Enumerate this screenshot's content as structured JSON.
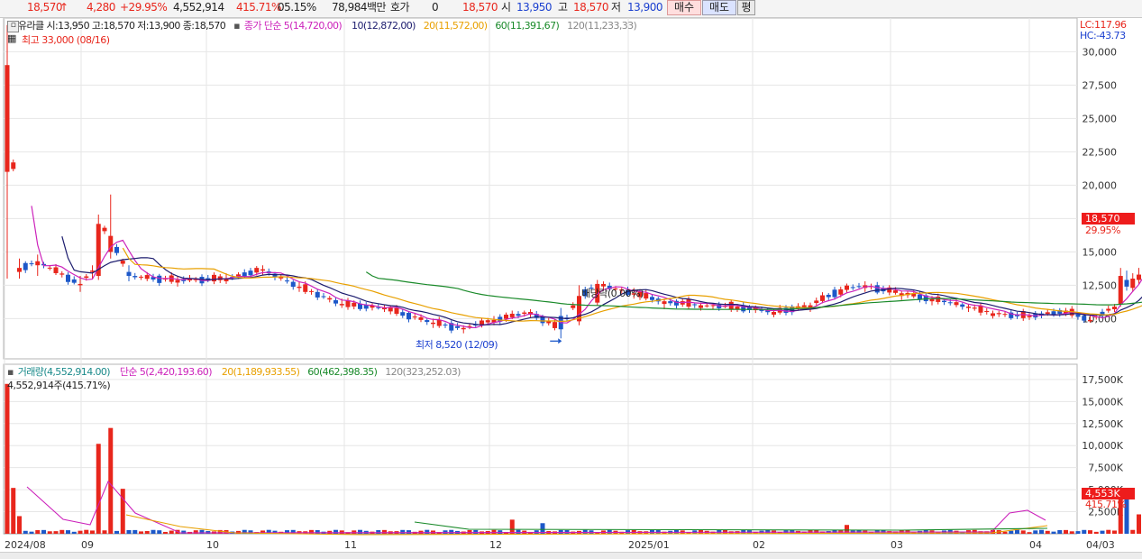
{
  "ticker": {
    "price": "18,570",
    "price_arrow": "↑",
    "change": "4,280",
    "change_pct": "+29.95%",
    "volume": "4,552,914",
    "volume_ratio": "415.71%",
    "turnover": "05.15%",
    "trade_value": "78,984백만",
    "hoga_label": "호가",
    "hoga_value": "0",
    "hoga_price": "18,570",
    "open_label": "시",
    "open_value": "13,950",
    "high_label": "고",
    "high_value": "18,570",
    "low_label": "저",
    "low_value": "13,900",
    "buy_button": "매수",
    "sell_button": "매도",
    "avg_button": "평"
  },
  "price_panel": {
    "stock_legend": "유라클 시:13,950 고:18,570 저:13,900 종:18,570",
    "ma_title": "종가 단순 5(14,720,00)",
    "ma10": "10(12,872,00)",
    "ma20": "20(11,572,00)",
    "ma60": "60(11,391,67)",
    "ma120": "120(11,233,33)",
    "high_note": "최고 33,000 (08/16)",
    "low_note": "최저 8,520 (12/09)",
    "dividend_note": "배당락(0.00%)",
    "lc": "LC:117.96",
    "hc": "HC:-43.73",
    "price_tag": "18,570",
    "pct_tag": "29.95%",
    "y_ticks": [
      "30,000",
      "27,500",
      "25,000",
      "22,500",
      "20,000",
      "17,500",
      "15,000",
      "12,500",
      "10,000"
    ]
  },
  "volume_panel": {
    "legend_title": "거래량(4,552,914.00)",
    "ma5": "단순 5(2,420,193.60)",
    "ma20": "20(1,189,933.55)",
    "ma60": "60(462,398.35)",
    "ma120": "120(323,252.03)",
    "current_note": "4,552,914주(415.71%)",
    "volume_tag": "4,553K",
    "pct_tag": "415.71%",
    "y_ticks": [
      "17,500K",
      "15,000K",
      "12,500K",
      "10,000K",
      "7,500K",
      "5,000K",
      "2,500K"
    ]
  },
  "x_axis": {
    "labels": [
      "2024/08",
      "09",
      "10",
      "11",
      "12",
      "2025/01",
      "02",
      "03",
      "04",
      "04/03"
    ]
  },
  "colors": {
    "up": "#e8261c",
    "down": "#1d58c9",
    "ma5": "#cc22bb",
    "ma10": "#1c1c6e",
    "ma20": "#e8a000",
    "ma60": "#1a8a2a",
    "ma120": "#999999"
  },
  "chart_data": {
    "type": "candlestick",
    "title": "유라클",
    "y_range": [
      8000,
      33000
    ],
    "volume_range": [
      0,
      18000000
    ],
    "categories": [
      "2024/08",
      "09",
      "10",
      "11",
      "12",
      "2025/01",
      "02",
      "03",
      "04"
    ],
    "series": [
      {
        "name": "종가",
        "values": [
          27800,
          13500,
          12900,
          11100,
          9100,
          10700,
          11800,
          10400,
          18570
        ]
      },
      {
        "name": "거래량",
        "values": [
          17000000,
          12000000,
          500000,
          200000,
          1600000,
          300000,
          800000,
          200000,
          4552914
        ]
      }
    ],
    "high": {
      "value": 33000,
      "date": "08/16"
    },
    "low": {
      "value": 8520,
      "date": "12/09"
    }
  }
}
